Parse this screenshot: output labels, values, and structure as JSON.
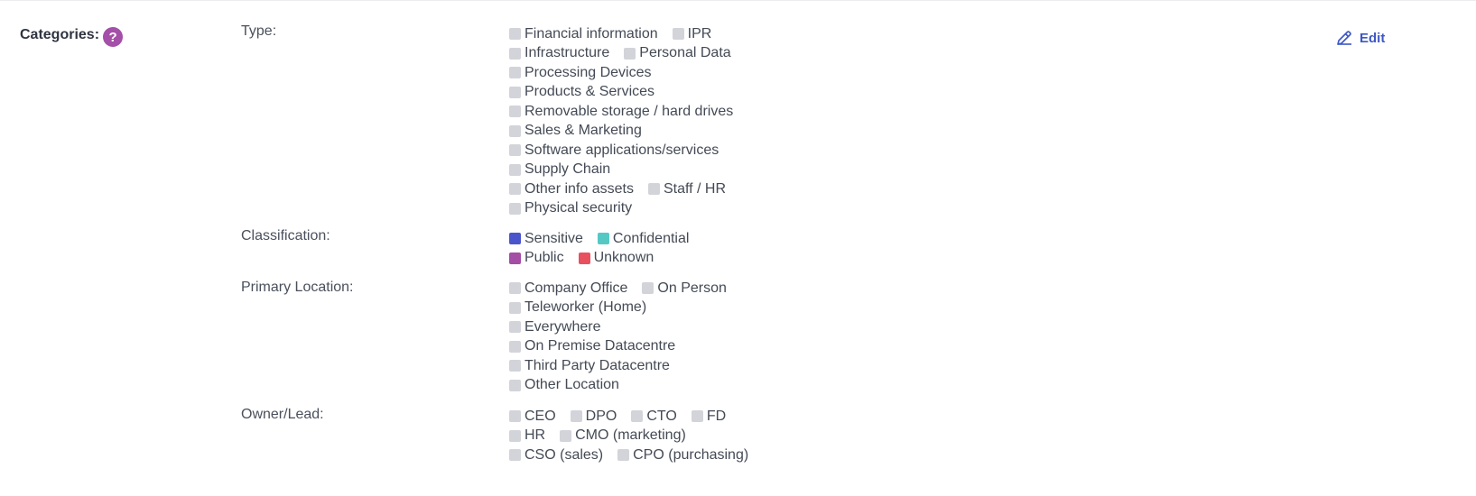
{
  "section": {
    "title": "Categories:",
    "help_glyph": "?",
    "edit_label": "Edit"
  },
  "colors": {
    "accent": "#3d57c4",
    "help": "#a44fa8",
    "unchecked": "#d2d4da"
  },
  "rows": [
    {
      "label": "Type:",
      "lines": [
        [
          {
            "text": "Financial information",
            "color": "#d2d4da"
          },
          {
            "text": "IPR",
            "color": "#d2d4da"
          }
        ],
        [
          {
            "text": "Infrastructure",
            "color": "#d2d4da"
          },
          {
            "text": "Personal Data",
            "color": "#d2d4da"
          }
        ],
        [
          {
            "text": "Processing Devices",
            "color": "#d2d4da"
          }
        ],
        [
          {
            "text": "Products & Services",
            "color": "#d2d4da"
          }
        ],
        [
          {
            "text": "Removable storage / hard drives",
            "color": "#d2d4da"
          }
        ],
        [
          {
            "text": "Sales & Marketing",
            "color": "#d2d4da"
          }
        ],
        [
          {
            "text": "Software applications/services",
            "color": "#d2d4da"
          }
        ],
        [
          {
            "text": "Supply Chain",
            "color": "#d2d4da"
          }
        ],
        [
          {
            "text": "Other info assets",
            "color": "#d2d4da"
          },
          {
            "text": "Staff / HR",
            "color": "#d2d4da"
          }
        ],
        [
          {
            "text": "Physical security",
            "color": "#d2d4da"
          }
        ]
      ]
    },
    {
      "label": "Classification:",
      "lines": [
        [
          {
            "text": "Sensitive",
            "color": "#4a55cc"
          },
          {
            "text": "Confidential",
            "color": "#55c8c4"
          }
        ],
        [
          {
            "text": "Public",
            "color": "#a34da4"
          },
          {
            "text": "Unknown",
            "color": "#e8505f"
          }
        ]
      ]
    },
    {
      "label": "Primary Location:",
      "lines": [
        [
          {
            "text": "Company Office",
            "color": "#d2d4da"
          },
          {
            "text": "On Person",
            "color": "#d2d4da"
          }
        ],
        [
          {
            "text": "Teleworker (Home)",
            "color": "#d2d4da"
          }
        ],
        [
          {
            "text": "Everywhere",
            "color": "#d2d4da"
          }
        ],
        [
          {
            "text": "On Premise Datacentre",
            "color": "#d2d4da"
          }
        ],
        [
          {
            "text": "Third Party Datacentre",
            "color": "#d2d4da"
          }
        ],
        [
          {
            "text": "Other Location",
            "color": "#d2d4da"
          }
        ]
      ]
    },
    {
      "label": "Owner/Lead:",
      "lines": [
        [
          {
            "text": "CEO",
            "color": "#d2d4da"
          },
          {
            "text": "DPO",
            "color": "#d2d4da"
          },
          {
            "text": "CTO",
            "color": "#d2d4da"
          },
          {
            "text": "FD",
            "color": "#d2d4da"
          }
        ],
        [
          {
            "text": "HR",
            "color": "#d2d4da"
          },
          {
            "text": "CMO (marketing)",
            "color": "#d2d4da"
          }
        ],
        [
          {
            "text": "CSO (sales)",
            "color": "#d2d4da"
          },
          {
            "text": "CPO (purchasing)",
            "color": "#d2d4da"
          }
        ]
      ]
    }
  ]
}
